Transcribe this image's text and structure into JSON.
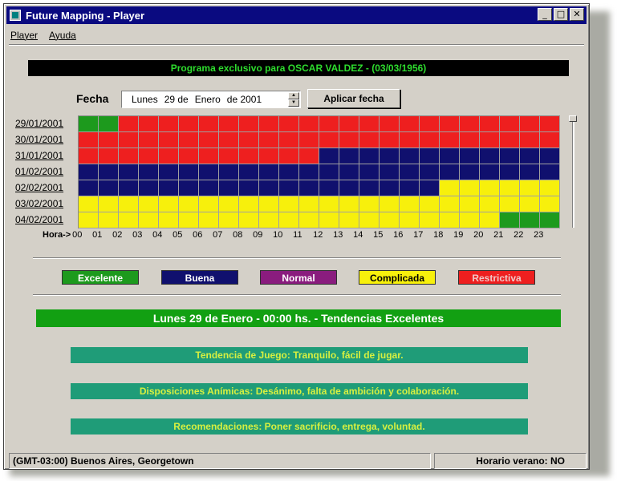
{
  "window": {
    "title": "Future Mapping - Player"
  },
  "menu": {
    "items": [
      "Player",
      "Ayuda"
    ]
  },
  "program_banner": "Programa exclusivo para OSCAR VALDEZ - (03/03/1956)",
  "fecha": {
    "label": "Fecha",
    "weekday": "Lunes",
    "day": "29 de",
    "month": "Enero",
    "year": "de 2001",
    "apply_label": "Aplicar fecha"
  },
  "grid": {
    "dates": [
      "29/01/2001",
      "30/01/2001",
      "31/01/2001",
      "01/02/2001",
      "02/02/2001",
      "03/02/2001",
      "04/02/2001"
    ],
    "hours_label": "Hora->",
    "hours": [
      "00",
      "01",
      "02",
      "03",
      "04",
      "05",
      "06",
      "07",
      "08",
      "09",
      "10",
      "11",
      "12",
      "13",
      "14",
      "15",
      "16",
      "17",
      "18",
      "19",
      "20",
      "21",
      "22",
      "23"
    ],
    "rows": [
      [
        "E",
        "E",
        "R",
        "R",
        "R",
        "R",
        "R",
        "R",
        "R",
        "R",
        "R",
        "R",
        "R",
        "R",
        "R",
        "R",
        "R",
        "R",
        "R",
        "R",
        "R",
        "R",
        "R",
        "R"
      ],
      [
        "R",
        "R",
        "R",
        "R",
        "R",
        "R",
        "R",
        "R",
        "R",
        "R",
        "R",
        "R",
        "R",
        "R",
        "R",
        "R",
        "R",
        "R",
        "R",
        "R",
        "R",
        "R",
        "R",
        "R"
      ],
      [
        "R",
        "R",
        "R",
        "R",
        "R",
        "R",
        "R",
        "R",
        "R",
        "R",
        "R",
        "R",
        "B",
        "B",
        "B",
        "B",
        "B",
        "B",
        "B",
        "B",
        "B",
        "B",
        "B",
        "B"
      ],
      [
        "B",
        "B",
        "B",
        "B",
        "B",
        "B",
        "B",
        "B",
        "B",
        "B",
        "B",
        "B",
        "B",
        "B",
        "B",
        "B",
        "B",
        "B",
        "B",
        "B",
        "B",
        "B",
        "B",
        "B"
      ],
      [
        "B",
        "B",
        "B",
        "B",
        "B",
        "B",
        "B",
        "B",
        "B",
        "B",
        "B",
        "B",
        "B",
        "B",
        "B",
        "B",
        "B",
        "B",
        "C",
        "C",
        "C",
        "C",
        "C",
        "C"
      ],
      [
        "C",
        "C",
        "C",
        "C",
        "C",
        "C",
        "C",
        "C",
        "C",
        "C",
        "C",
        "C",
        "C",
        "C",
        "C",
        "C",
        "C",
        "C",
        "C",
        "C",
        "C",
        "C",
        "C",
        "C"
      ],
      [
        "C",
        "C",
        "C",
        "C",
        "C",
        "C",
        "C",
        "C",
        "C",
        "C",
        "C",
        "C",
        "C",
        "C",
        "C",
        "C",
        "C",
        "C",
        "C",
        "C",
        "C",
        "E",
        "E",
        "E"
      ]
    ]
  },
  "legend": {
    "excelente": "Excelente",
    "buena": "Buena",
    "normal": "Normal",
    "complicada": "Complicada",
    "restrictiva": "Restrictiva"
  },
  "colors": {
    "E": "#1d9a1d",
    "B": "#10106e",
    "N": "#8a1c7e",
    "C": "#f7f00c",
    "R": "#ee1f1f"
  },
  "legend_text_colors": {
    "excelente": "#ffffff",
    "buena": "#ffffff",
    "normal": "#ffffff",
    "complicada": "#000000",
    "restrictiva": "#f0c8c8"
  },
  "summary": "Lunes 29 de Enero - 00:00 hs. - Tendencias Excelentes",
  "details": {
    "juego": "Tendencia de Juego: Tranquilo, fácil de jugar.",
    "animicas": "Disposiciones Anímicas: Desánimo, falta de ambición y colaboración.",
    "recomendaciones": "Recomendaciones: Poner sacrificio, entrega, voluntad."
  },
  "status": {
    "timezone": "(GMT-03:00) Buenos Aires, Georgetown",
    "dst": "Horario verano: NO"
  }
}
